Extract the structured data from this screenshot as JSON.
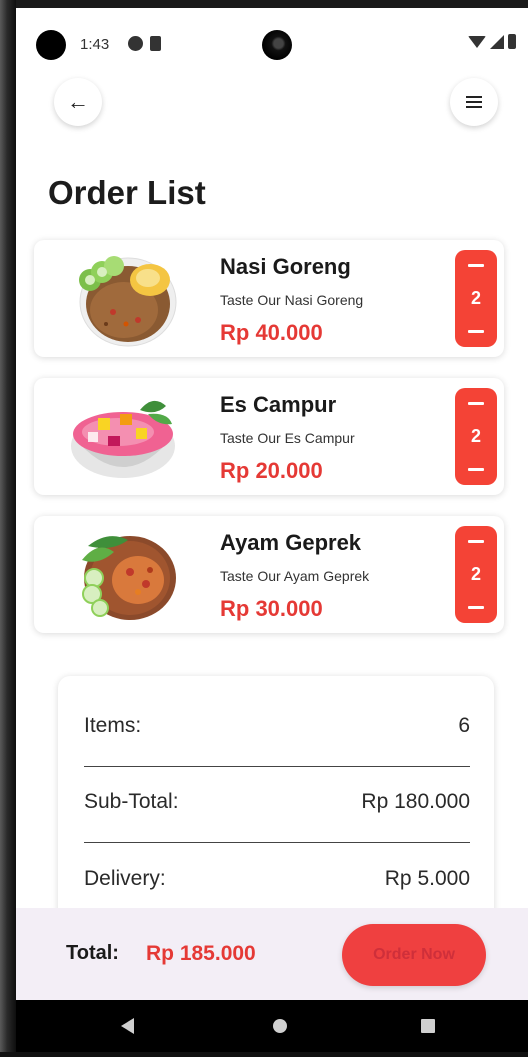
{
  "status_bar": {
    "time": "1:43"
  },
  "header": {
    "back_icon": "arrow-left-icon",
    "back_glyph": "←",
    "menu_icon": "hamburger-menu-icon"
  },
  "page": {
    "title": "Order List"
  },
  "orders": [
    {
      "name": "Nasi Goreng",
      "description": "Taste Our Nasi Goreng",
      "price": "Rp 40.000",
      "quantity": "2"
    },
    {
      "name": "Es Campur",
      "description": "Taste Our Es Campur",
      "price": "Rp 20.000",
      "quantity": "2"
    },
    {
      "name": "Ayam Geprek",
      "description": "Taste Our Ayam Geprek",
      "price": "Rp 30.000",
      "quantity": "2"
    }
  ],
  "summary": {
    "items_label": "Items:",
    "items_value": "6",
    "subtotal_label": "Sub-Total:",
    "subtotal_value": "Rp 180.000",
    "delivery_label": "Delivery:",
    "delivery_value": "Rp 5.000"
  },
  "footer": {
    "total_label": "Total:",
    "total_value": "Rp 185.000",
    "order_button": "Order Now"
  },
  "colors": {
    "accent": "#f44336",
    "price": "#e53935",
    "bottom_bar": "#f3eef6"
  }
}
